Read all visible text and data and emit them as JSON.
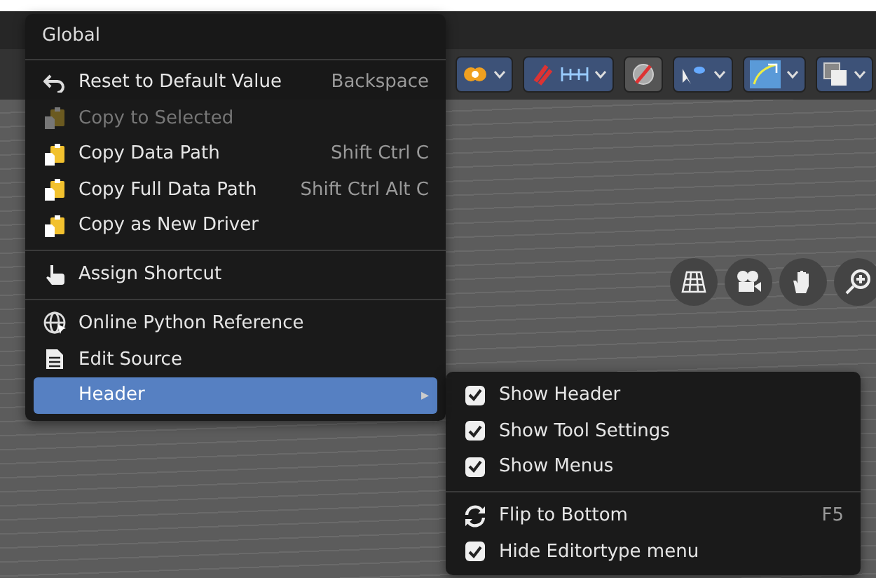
{
  "context_menu": {
    "title": "Global",
    "items": [
      {
        "kind": "item",
        "label": "Reset to Default Value",
        "shortcut": "Backspace",
        "disabled": false,
        "selected": false
      },
      {
        "kind": "item",
        "label": "Copy to Selected",
        "disabled": true,
        "selected": false
      },
      {
        "kind": "item",
        "label": "Copy Data Path",
        "shortcut": "Shift Ctrl C",
        "disabled": false,
        "selected": false
      },
      {
        "kind": "item",
        "label": "Copy Full Data Path",
        "shortcut": "Shift Ctrl Alt C",
        "disabled": false,
        "selected": false
      },
      {
        "kind": "item",
        "label": "Copy as New Driver",
        "disabled": false,
        "selected": false
      },
      {
        "kind": "separator"
      },
      {
        "kind": "item",
        "label": "Assign Shortcut",
        "disabled": false,
        "selected": false
      },
      {
        "kind": "separator"
      },
      {
        "kind": "item",
        "label": "Online Python Reference",
        "disabled": false,
        "selected": false
      },
      {
        "kind": "item",
        "label": "Edit Source",
        "disabled": false,
        "selected": false
      },
      {
        "kind": "submenu",
        "label": "Header",
        "arrow": "▸",
        "disabled": false,
        "selected": true
      }
    ]
  },
  "submenu": {
    "items": [
      {
        "kind": "check",
        "label": "Show Header",
        "checked": true
      },
      {
        "kind": "check",
        "label": "Show Tool Settings",
        "checked": true
      },
      {
        "kind": "check",
        "label": "Show Menus",
        "checked": true
      },
      {
        "kind": "separator"
      },
      {
        "kind": "item",
        "label": "Flip to Bottom",
        "shortcut": "F5"
      },
      {
        "kind": "check",
        "label": "Hide Editortype menu",
        "checked": true
      }
    ]
  }
}
